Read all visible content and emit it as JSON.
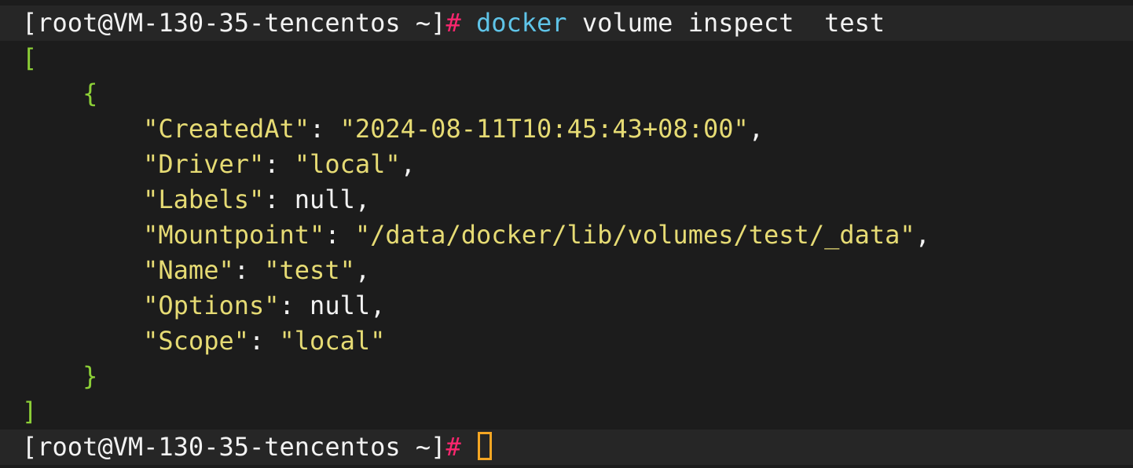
{
  "terminal": {
    "prompt": "[root@VM-130-35-tencentos ~]",
    "hash": "#",
    "command": {
      "name": "docker",
      "args": "volume inspect  test"
    },
    "output": {
      "open_array": "[",
      "open_object": "{",
      "entries": [
        {
          "key": "\"CreatedAt\"",
          "sep": ": ",
          "value": "\"2024-08-11T10:45:43+08:00\"",
          "value_type": "string",
          "trail": ","
        },
        {
          "key": "\"Driver\"",
          "sep": ": ",
          "value": "\"local\"",
          "value_type": "string",
          "trail": ","
        },
        {
          "key": "\"Labels\"",
          "sep": ": ",
          "value": "null",
          "value_type": "null",
          "trail": ","
        },
        {
          "key": "\"Mountpoint\"",
          "sep": ": ",
          "value": "\"/data/docker/lib/volumes/test/_data\"",
          "value_type": "string",
          "trail": ","
        },
        {
          "key": "\"Name\"",
          "sep": ": ",
          "value": "\"test\"",
          "value_type": "string",
          "trail": ","
        },
        {
          "key": "\"Options\"",
          "sep": ": ",
          "value": "null",
          "value_type": "null",
          "trail": ","
        },
        {
          "key": "\"Scope\"",
          "sep": ": ",
          "value": "\"local\"",
          "value_type": "string",
          "trail": ""
        }
      ],
      "close_object": "}",
      "close_array": "]"
    },
    "colors": {
      "background": "#1c1c1c",
      "prompt_hash": "#f9266e",
      "command": "#5fc4e8",
      "bracket": "#8ccf37",
      "json_string": "#e6db74",
      "cursor": "#f5a623"
    }
  }
}
